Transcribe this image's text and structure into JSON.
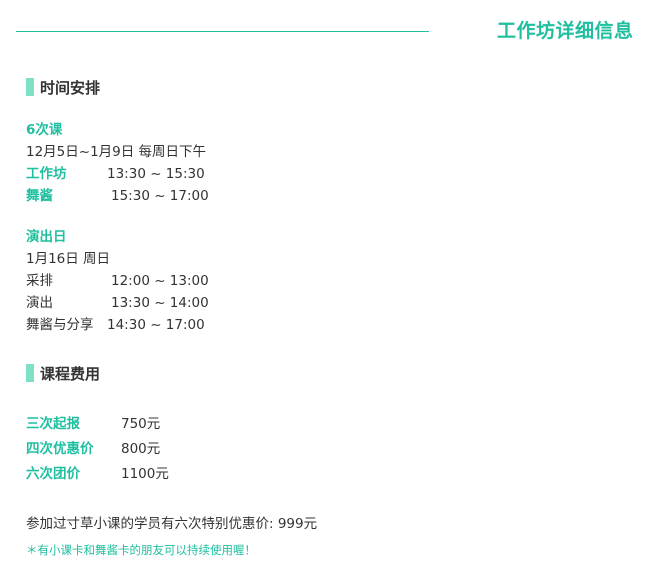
{
  "header": {
    "title": "工作坊详细信息"
  },
  "schedule": {
    "section_title": "时间安排",
    "block1": {
      "heading": "6次课",
      "date": "12月5日~1月9日 每周日下午",
      "rows": [
        {
          "label": "工作坊",
          "time": "13:30 ~ 15:30"
        },
        {
          "label": "舞酱",
          "time": "15:30 ~ 17:00"
        }
      ]
    },
    "block2": {
      "heading": "演出日",
      "date": "1月16日 周日",
      "rows": [
        {
          "label": "采排",
          "time": "12:00 ~ 13:00"
        },
        {
          "label": "演出",
          "time": "13:30 ~ 14:00"
        },
        {
          "label": "舞酱与分享",
          "time": "14:30 ~ 17:00"
        }
      ]
    }
  },
  "fees": {
    "section_title": "课程费用",
    "rows": [
      {
        "label": "三次起报",
        "price": "750元"
      },
      {
        "label": "四次优惠价",
        "price": "800元"
      },
      {
        "label": "六次团价",
        "price": "1100元"
      }
    ],
    "special": "参加过寸草小课的学员有六次特别优惠价:  999元",
    "note": "＊有小课卡和舞酱卡的朋友可以持续使用喔！"
  },
  "colors": {
    "accent": "#1fbf9f",
    "section_bar": "#7fe0c8",
    "text": "#333333"
  }
}
